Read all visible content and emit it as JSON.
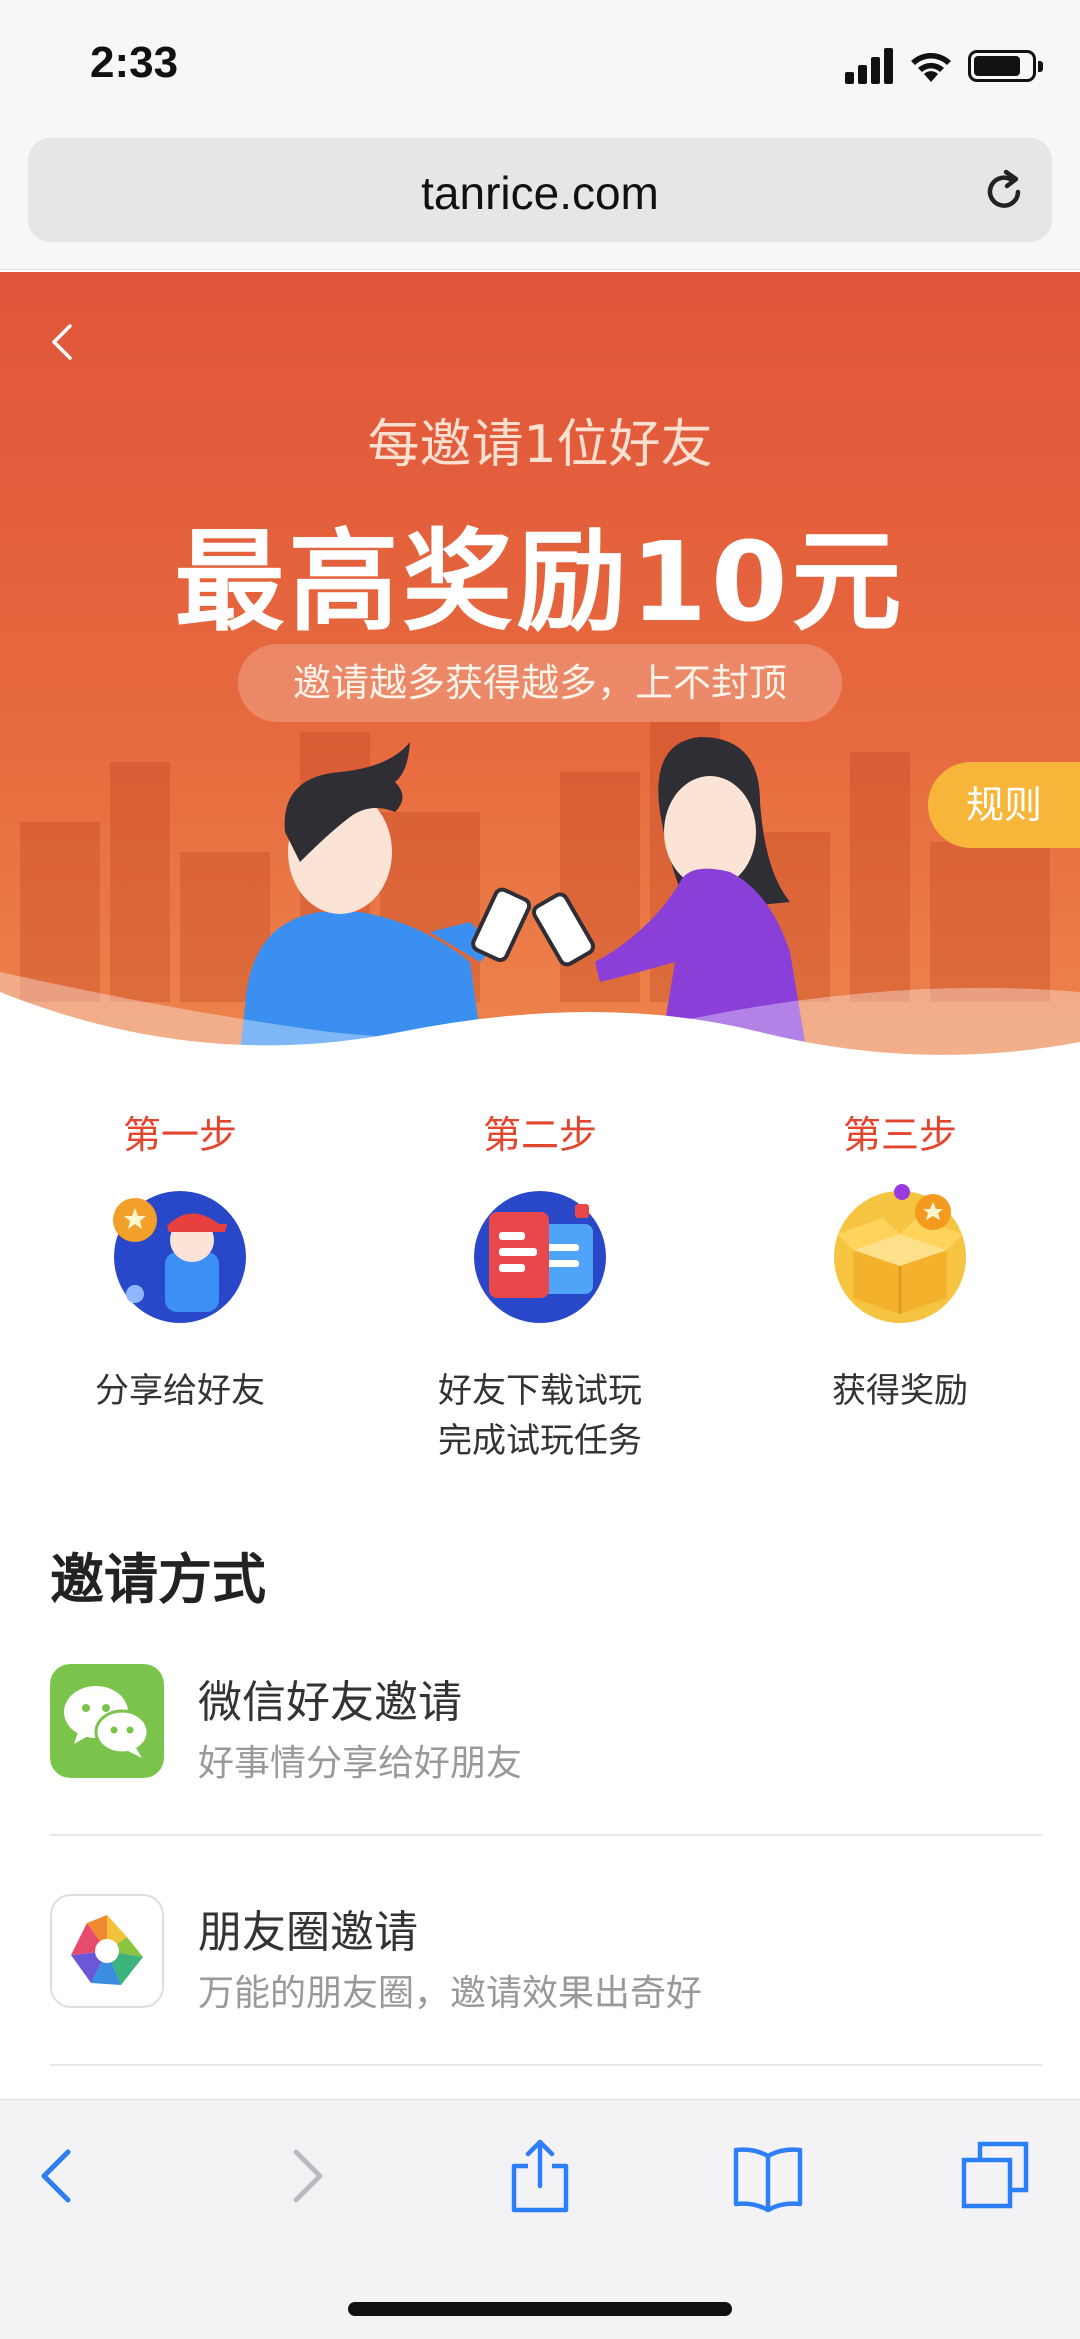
{
  "status_bar": {
    "time": "2:33"
  },
  "browser": {
    "url": "tanrice.com"
  },
  "hero": {
    "subtitle": "每邀请1位好友",
    "title": "最高奖励10元",
    "pill_text": "邀请越多获得越多，上不封顶",
    "rules_label": "规则"
  },
  "steps": [
    {
      "label": "第一步",
      "text_lines": [
        "分享给好友"
      ],
      "icon": "share-friend-icon"
    },
    {
      "label": "第二步",
      "text_lines": [
        "好友下载试玩",
        "完成试玩任务"
      ],
      "icon": "download-trial-icon"
    },
    {
      "label": "第三步",
      "text_lines": [
        "获得奖励"
      ],
      "icon": "reward-box-icon"
    }
  ],
  "methods": {
    "title": "邀请方式",
    "items": [
      {
        "title": "微信好友邀请",
        "desc": "好事情分享给好朋友",
        "icon": "wechat-icon",
        "color": "#7bc44b"
      },
      {
        "title": "朋友圈邀请",
        "desc": "万能的朋友圈，邀请效果出奇好",
        "icon": "moments-icon"
      }
    ]
  },
  "toolbar": {
    "items": [
      "back-icon",
      "forward-icon",
      "share-icon",
      "bookmarks-icon",
      "tabs-icon"
    ],
    "accent": "#2d7ff9"
  },
  "colors": {
    "hero": "#e0553a",
    "step_label": "#e2462f",
    "rules": "#f7b53a"
  }
}
